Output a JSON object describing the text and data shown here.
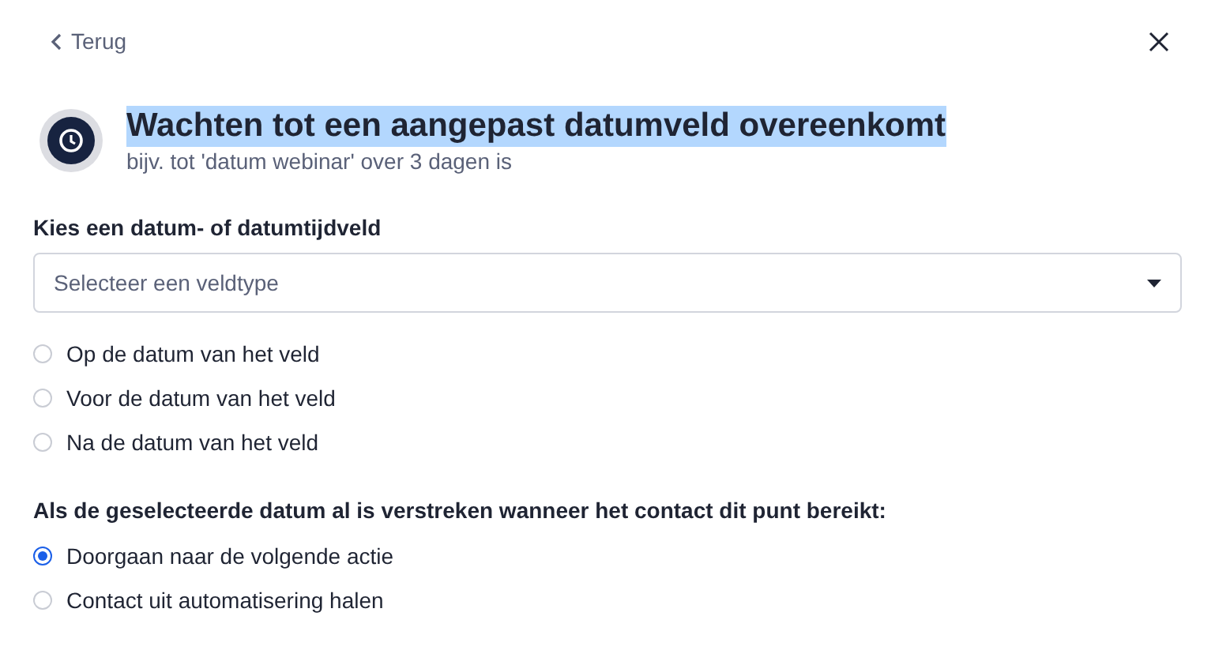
{
  "back_link": {
    "label": "Terug"
  },
  "header": {
    "title": "Wachten tot een aangepast datumveld overeenkomt",
    "title_highlighted": true,
    "subtitle": "bijv. tot 'datum webinar' over 3 dagen is"
  },
  "field": {
    "label": "Kies een datum- of datumtijdveld",
    "placeholder": "Selecteer een veldtype"
  },
  "timing_options": [
    {
      "label": "Op de datum van het veld",
      "selected": false
    },
    {
      "label": "Voor de datum van het veld",
      "selected": false
    },
    {
      "label": "Na de datum van het veld",
      "selected": false
    }
  ],
  "expired": {
    "label": "Als de geselecteerde datum al is verstreken wanneer het contact dit punt bereikt:",
    "options": [
      {
        "label": "Doorgaan naar de volgende actie",
        "selected": true
      },
      {
        "label": "Contact uit automatisering halen",
        "selected": false
      }
    ]
  }
}
